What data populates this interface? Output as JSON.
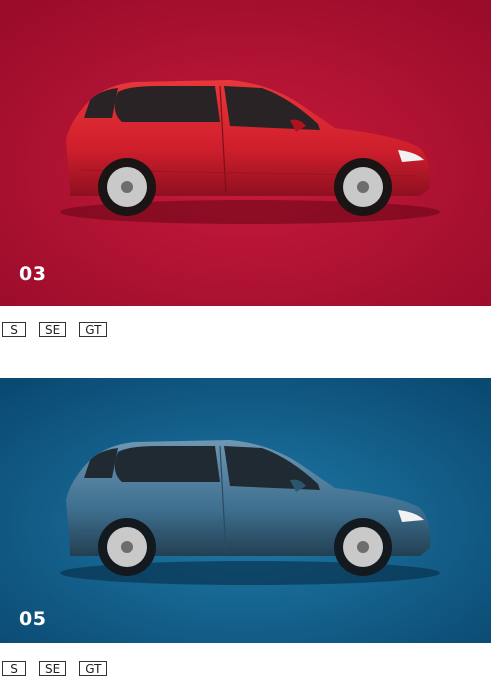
{
  "panels": [
    {
      "number": "03",
      "background": "#a60e2d",
      "car_color": "#cf1e2c",
      "trims": [
        "S",
        "SE",
        "GT"
      ]
    },
    {
      "number": "05",
      "background": "#0b4f78",
      "car_color": "#3e6f8f",
      "trims": [
        "S",
        "SE",
        "GT"
      ]
    }
  ]
}
